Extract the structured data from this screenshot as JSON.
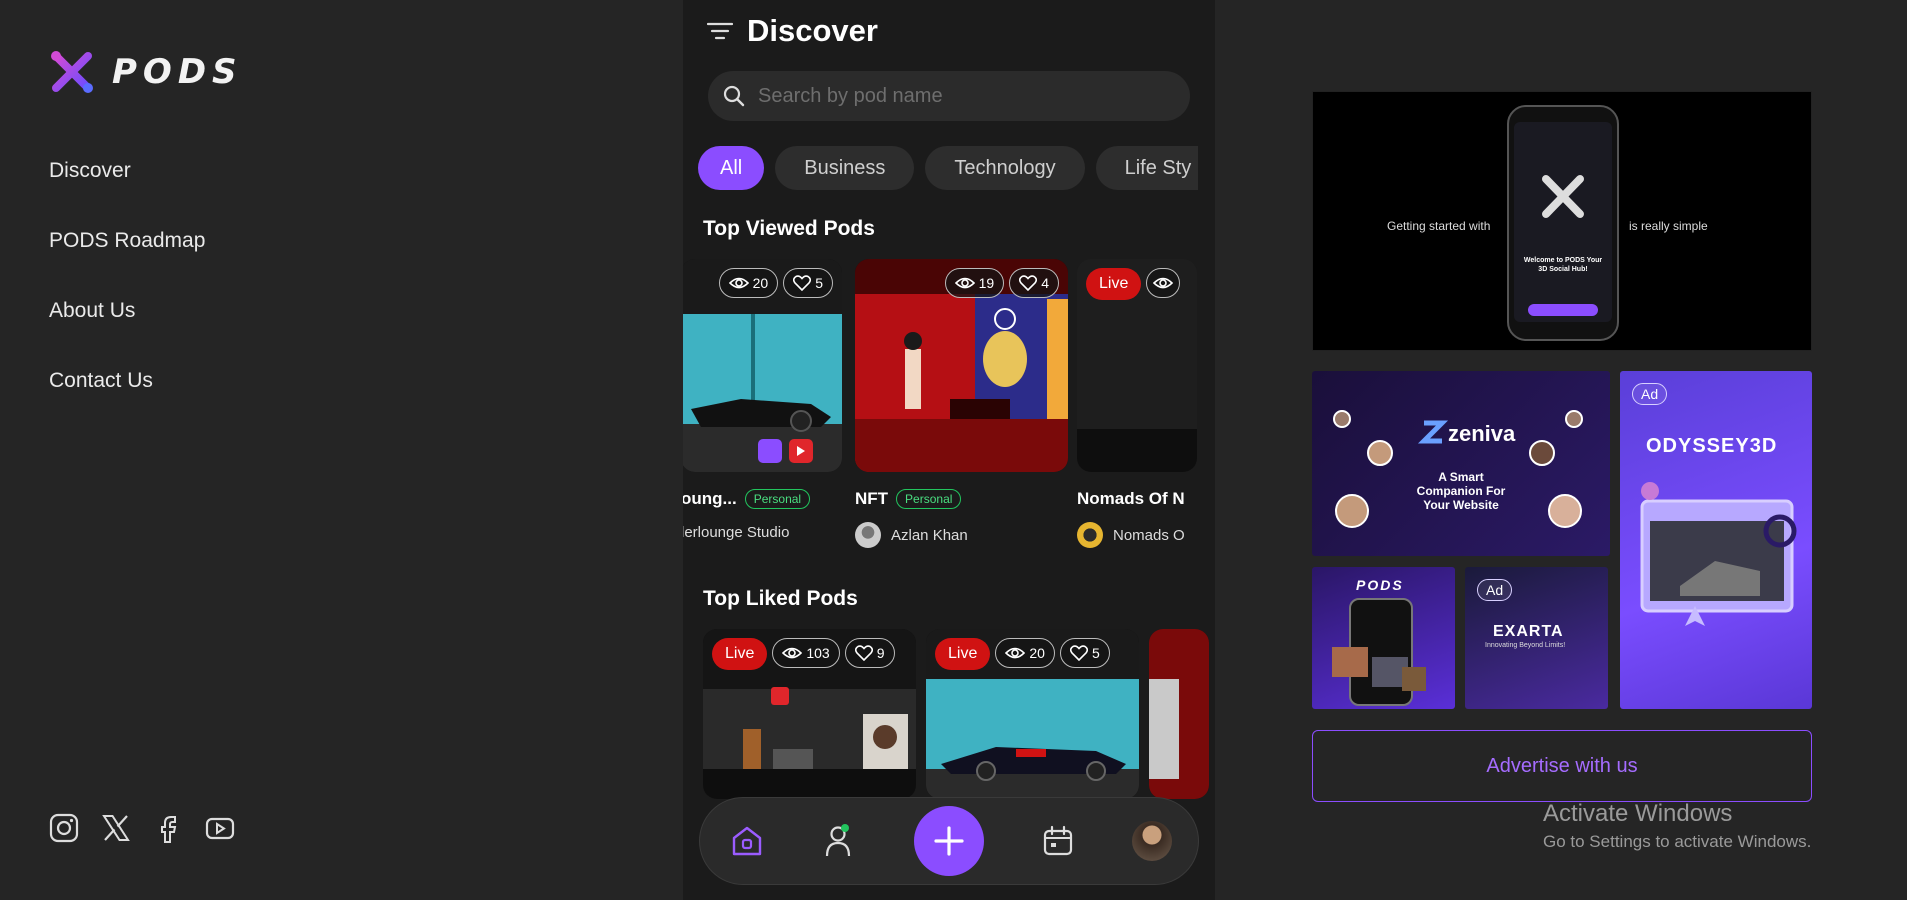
{
  "brand": {
    "name": "PODS"
  },
  "nav": {
    "items": [
      {
        "label": "Discover"
      },
      {
        "label": "PODS Roadmap"
      },
      {
        "label": "About Us"
      },
      {
        "label": "Contact Us"
      }
    ],
    "socials": [
      "instagram-icon",
      "x-icon",
      "facebook-icon",
      "youtube-icon"
    ]
  },
  "app": {
    "title": "Discover",
    "search_placeholder": "Search by pod name",
    "categories": [
      "All",
      "Business",
      "Technology",
      "Life Sty"
    ],
    "active_category": "All",
    "top_viewed": {
      "title": "Top Viewed Pods",
      "cards": [
        {
          "views": "20",
          "likes": "5",
          "name": "oung...",
          "tag": "Personal",
          "owner": "lerlounge Studio"
        },
        {
          "views": "19",
          "likes": "4",
          "name": "NFT",
          "tag": "Personal",
          "owner": "Azlan Khan"
        },
        {
          "live": "Live",
          "name": "Nomads Of N",
          "owner": "Nomads O"
        }
      ]
    },
    "top_liked": {
      "title": "Top Liked Pods",
      "cards": [
        {
          "live": "Live",
          "views": "103",
          "likes": "9"
        },
        {
          "live": "Live",
          "views": "20",
          "likes": "5"
        }
      ]
    }
  },
  "ads": {
    "hero": {
      "left_text": "Getting started with",
      "right_text": "is really simple",
      "phone_title": "Welcome to PODS Your 3D Social Hub!"
    },
    "zeniva": {
      "brand": "zeniva",
      "headline": "A Smart Companion For Your Website"
    },
    "odyssey": {
      "ad_label": "Ad",
      "brand": "ODYSSEY3D"
    },
    "pods_small": {
      "brand": "PODS"
    },
    "exarta": {
      "ad_label": "Ad",
      "brand": "EXARTA",
      "tagline": "Innovating Beyond Limits!"
    },
    "advertise_label": "Advertise with us"
  },
  "windows_watermark": {
    "line1": "Activate Windows",
    "line2": "Go to Settings to activate Windows."
  },
  "colors": {
    "accent": "#8b4dff",
    "live": "#d01212",
    "tag": "#22c55e"
  }
}
